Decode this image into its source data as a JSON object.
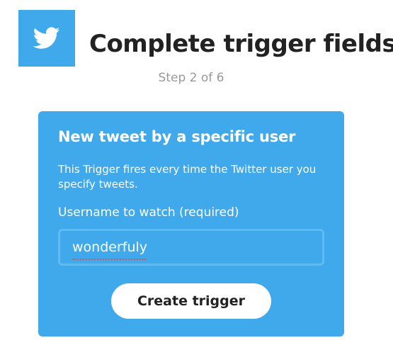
{
  "header": {
    "service_icon": "twitter-bird-icon",
    "title": "Complete trigger fields",
    "step": "Step 2 of 6"
  },
  "trigger_card": {
    "title": "New tweet by a specific user",
    "description": "This Trigger fires every time the Twitter user you specify tweets.",
    "field_label": "Username to watch (required)",
    "field_value": "wonderfuly",
    "button_label": "Create trigger"
  },
  "colors": {
    "brand": "#3fa9ec",
    "title_text": "#222222",
    "muted_text": "#999999",
    "on_brand_text": "#ffffff"
  }
}
